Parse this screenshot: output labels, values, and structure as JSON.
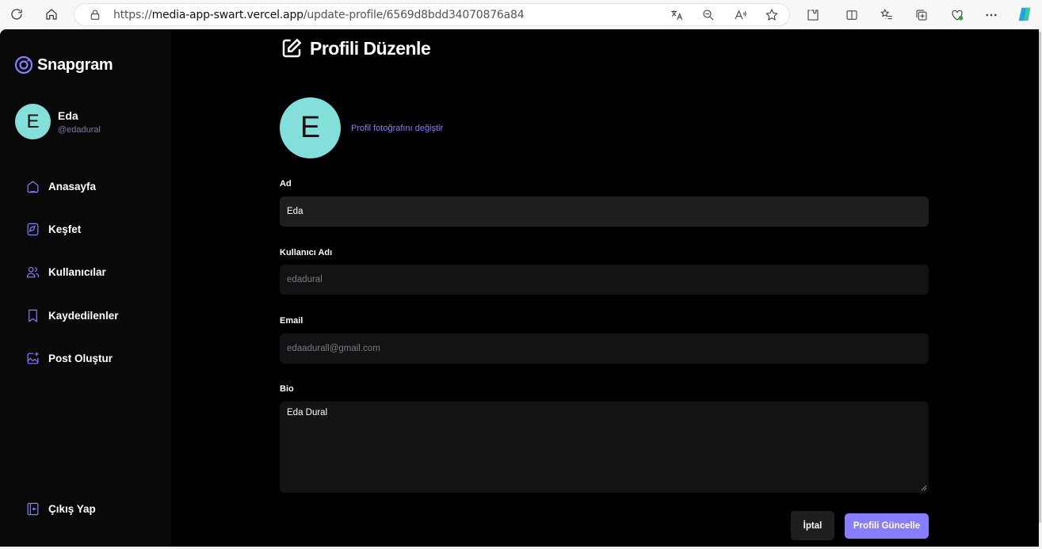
{
  "browser": {
    "url_prefix": "https://",
    "url_host": "media-app-swart.vercel.app",
    "url_path": "/update-profile/6569d8bdd34070876a84"
  },
  "sidebar": {
    "brand": "Snapgram",
    "user_initial": "E",
    "user_name": "Eda",
    "user_handle": "@edadural",
    "items": [
      {
        "label": "Anasayfa",
        "icon": "home-icon"
      },
      {
        "label": "Keşfet",
        "icon": "explore-icon"
      },
      {
        "label": "Kullanıcılar",
        "icon": "people-icon"
      },
      {
        "label": "Kaydedilenler",
        "icon": "bookmark-icon"
      },
      {
        "label": "Post Oluştur",
        "icon": "gallery-add-icon"
      }
    ],
    "logout_label": "Çıkış Yap"
  },
  "main": {
    "title": "Profili Düzenle",
    "avatar_initial": "E",
    "change_photo": "Profil fotoğrafını değiştir",
    "fields": {
      "name_label": "Ad",
      "name_value": "Eda",
      "username_label": "Kullanıcı Adı",
      "username_value": "edadural",
      "email_label": "Email",
      "email_value": "edaadurall@gmail.com",
      "bio_label": "Bio",
      "bio_value": "Eda Dural"
    },
    "cancel_label": "İptal",
    "submit_label": "Profili Güncelle"
  },
  "colors": {
    "accent": "#877eff",
    "avatar_bg": "#82dfd9",
    "background": "#000000",
    "sidebar_bg": "#09090a",
    "input_bg": "#1f1f22"
  }
}
